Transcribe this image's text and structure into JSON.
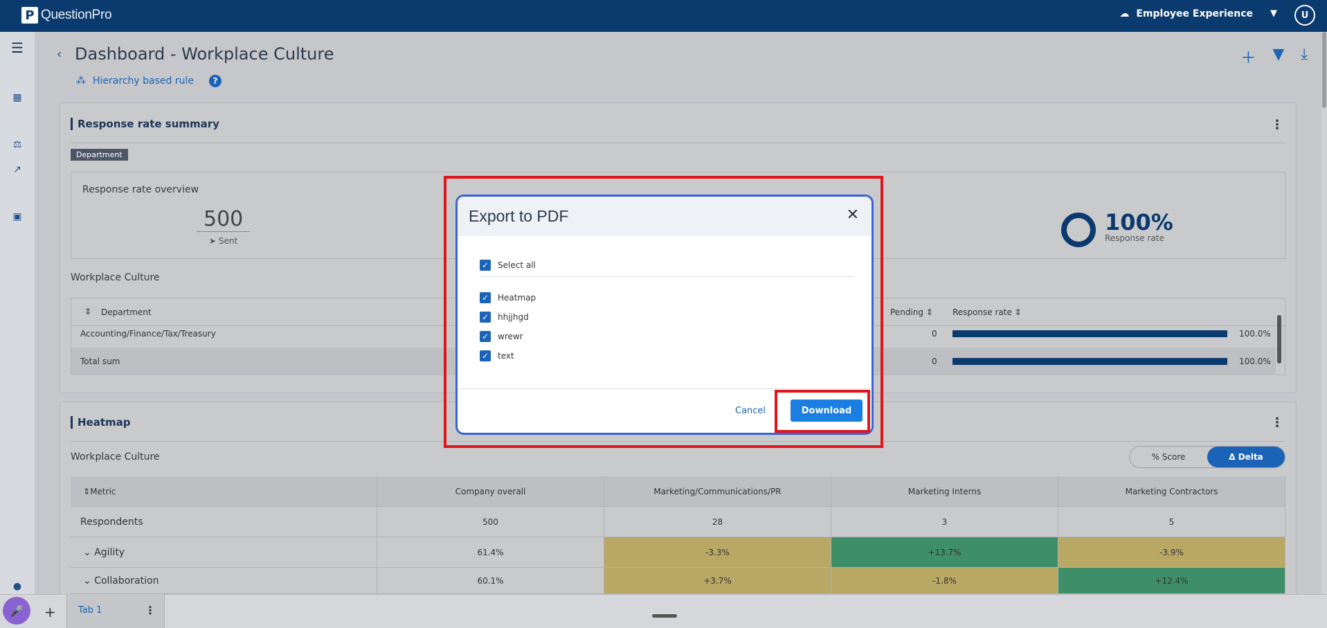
{
  "topbar": {
    "logo_letter": "P",
    "logo_text": "QuestionPro",
    "product": "Employee Experience",
    "caret": "▼",
    "avatar": "U"
  },
  "header": {
    "back": "‹",
    "title": "Dashboard - Workplace Culture",
    "hierarchy_rule": "Hierarchy based rule",
    "help": "?"
  },
  "response_card": {
    "title": "Response rate summary",
    "badge": "Department",
    "overview_title": "Response rate overview",
    "sent_value": "500",
    "sent_label": "Sent",
    "response_rate_value": "100%",
    "response_rate_label": "Response rate",
    "group_label": "Workplace Culture",
    "table": {
      "headers": {
        "department": "Department",
        "pending": "Pending",
        "response_rate": "Response rate"
      },
      "rows": [
        {
          "department": "Accounting/Finance/Tax/Treasury",
          "pending": "0",
          "rate": "100.0%",
          "rate_fraction": 1.0
        },
        {
          "department": "Total sum",
          "pending": "0",
          "rate": "100.0%",
          "rate_fraction": 1.0
        }
      ]
    }
  },
  "heatmap_card": {
    "title": "Heatmap",
    "group_label": "Workplace Culture",
    "toggle": {
      "score": "% Score",
      "delta": "Δ Delta"
    },
    "columns": [
      "Metric",
      "Company overall",
      "Marketing/Communications/PR",
      "Marketing Interns",
      "Marketing Contractors"
    ],
    "rows": [
      {
        "label": "Respondents",
        "values": [
          "500",
          "28",
          "3",
          "5"
        ]
      },
      {
        "label": "Agility",
        "values": [
          "61.4%",
          "-3.3%",
          "+13.7%",
          "-3.9%"
        ]
      },
      {
        "label": "Collaboration",
        "values": [
          "60.1%",
          "+3.7%",
          "-1.8%",
          "+12.4%"
        ]
      }
    ],
    "colors": {
      "yellow": "#b9a764",
      "green": "#3e8f67",
      "neutral": "#c9cacc"
    }
  },
  "bottom": {
    "add_tab": "+",
    "tab_label": "Tab 1",
    "tab_menu": "⋮"
  },
  "modal": {
    "title": "Export to PDF",
    "close": "✕",
    "select_all": "Select all",
    "items": [
      "Heatmap",
      "hhjjhgd",
      "wrewr",
      "text"
    ],
    "cancel": "Cancel",
    "download": "Download"
  },
  "colors": {
    "brand": "#0b3a6e",
    "accent": "#1a63b6",
    "highlight": "#e0141b"
  }
}
